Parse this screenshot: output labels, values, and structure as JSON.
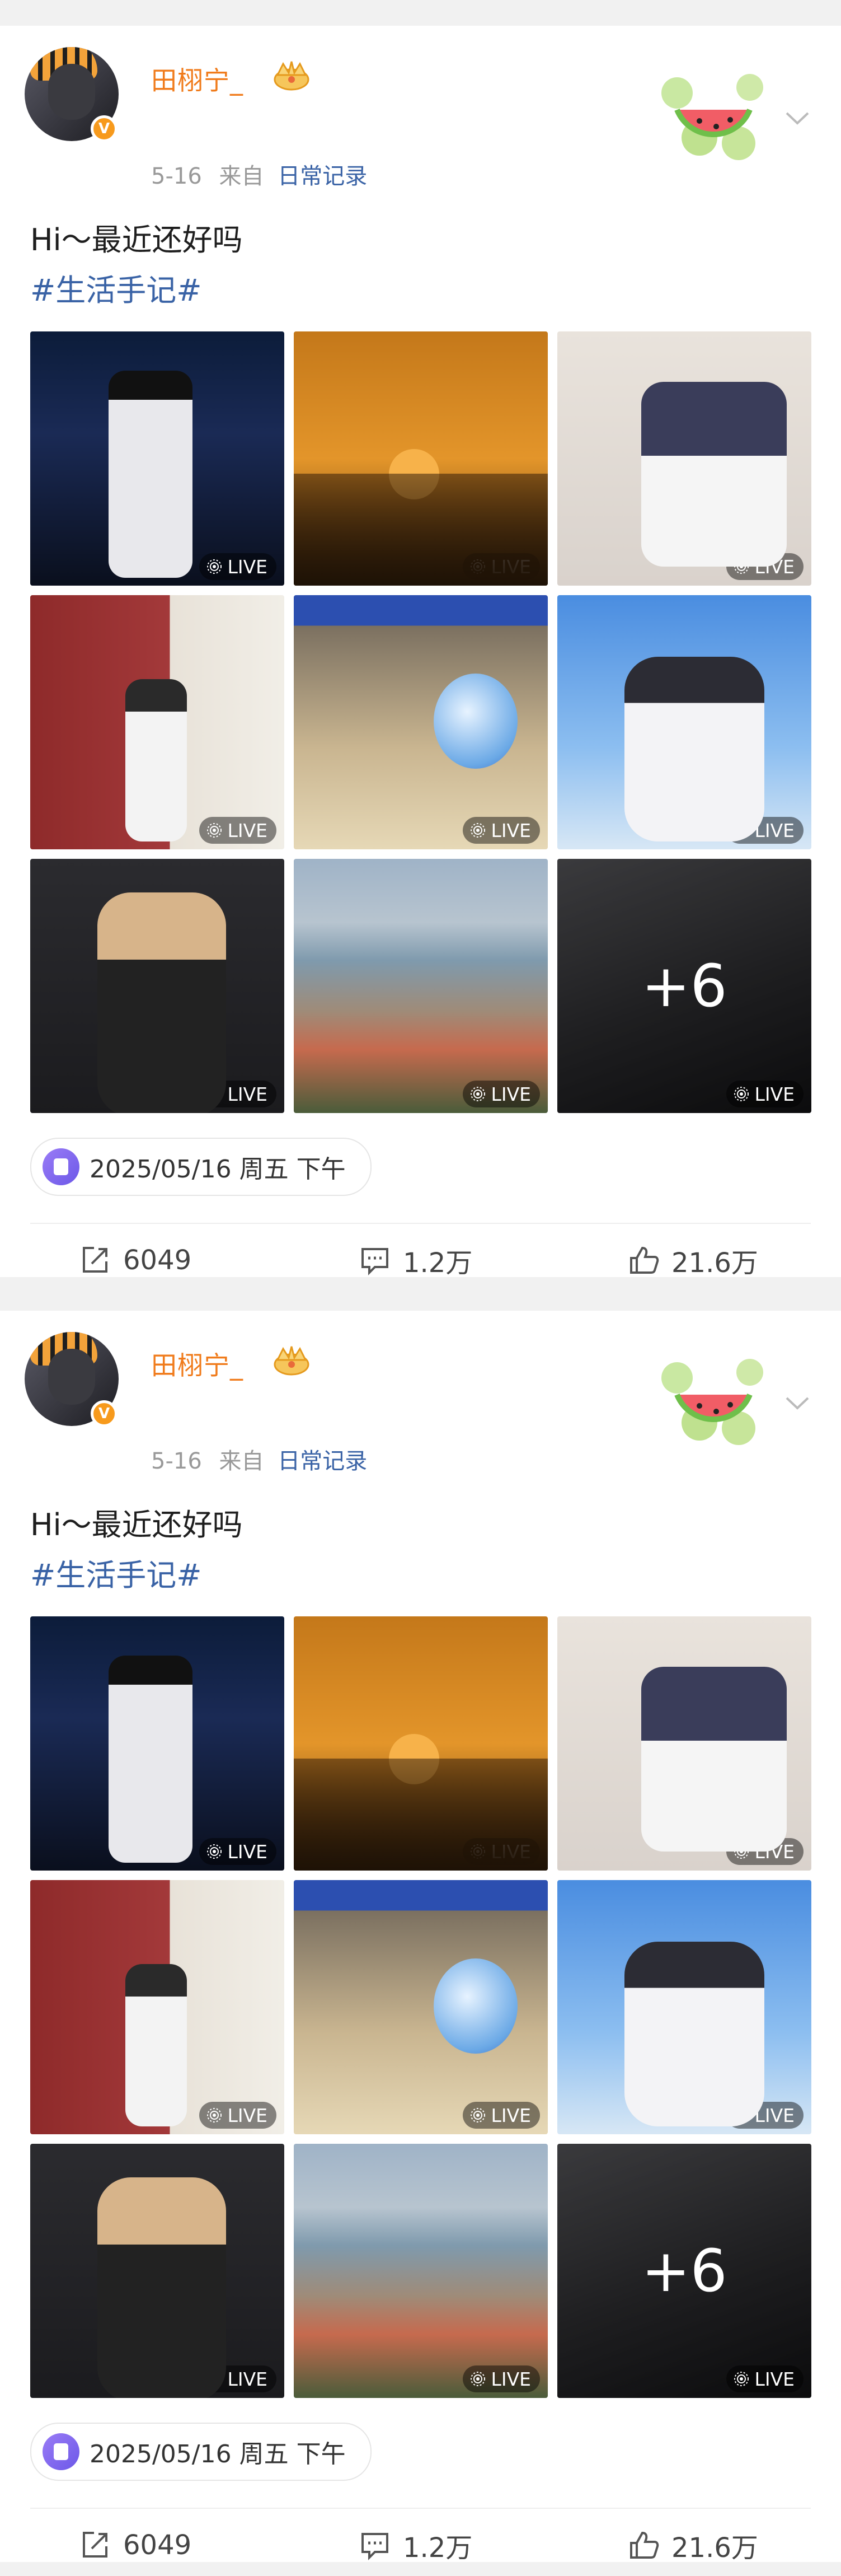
{
  "posts": [
    {
      "username": "田栩宁_",
      "date": "5-16",
      "from_label": "来自",
      "source": "日常记录",
      "text": "Hi～最近还好吗",
      "topic": "#生活手记#",
      "images": [
        {
          "badge": "LIVE"
        },
        {
          "badge": "LIVE"
        },
        {
          "badge": "LIVE"
        },
        {
          "badge": "LIVE"
        },
        {
          "badge": "LIVE"
        },
        {
          "badge": "LIVE"
        },
        {
          "badge": "LIVE"
        },
        {
          "badge": "LIVE"
        },
        {
          "badge": "LIVE",
          "overlay": "+6"
        }
      ],
      "location": "2025/05/16 周五 下午",
      "stats": {
        "reposts": "6049",
        "comments": "1.2万",
        "likes": "21.6万"
      }
    },
    {
      "username": "田栩宁_",
      "date": "5-16",
      "from_label": "来自",
      "source": "日常记录",
      "text": "Hi～最近还好吗",
      "topic": "#生活手记#",
      "images": [
        {
          "badge": "LIVE"
        },
        {
          "badge": "LIVE"
        },
        {
          "badge": "LIVE"
        },
        {
          "badge": "LIVE"
        },
        {
          "badge": "LIVE"
        },
        {
          "badge": "LIVE"
        },
        {
          "badge": "LIVE"
        },
        {
          "badge": "LIVE"
        },
        {
          "badge": "LIVE",
          "overlay": "+6"
        }
      ],
      "location": "2025/05/16 周五 下午",
      "stats": {
        "reposts": "6049",
        "comments": "1.2万",
        "likes": "21.6万"
      }
    }
  ],
  "colors": {
    "username": "#f07b1b",
    "link": "#3a63a6",
    "verified": "#f79a1c"
  }
}
